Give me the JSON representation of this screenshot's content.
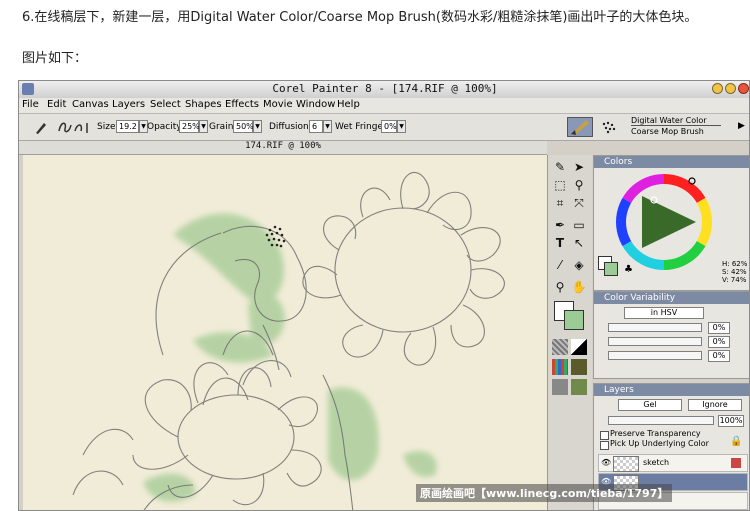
{
  "page": {
    "heading": "6.在线稿层下，新建一层，用Digital Water Color/Coarse Mop Brush(数码水彩/粗糙涂抹笔)画出叶子的大体色块。",
    "caption": "图片如下："
  },
  "window": {
    "title": "Corel Painter 8 - [174.RIF @ 100%]"
  },
  "menu": [
    "File",
    "Edit",
    "Canvas",
    "Layers",
    "Select",
    "Shapes",
    "Effects",
    "Movie",
    "Window",
    "Help"
  ],
  "property_bar": {
    "size_label": "Size:",
    "size_value": "19.2",
    "opacity_label": "Opacity:",
    "opacity_value": "25%",
    "grain_label": "Grain:",
    "grain_value": "50%",
    "diffusion_label": "Diffusion:",
    "diffusion_value": "6",
    "wet_fringe_label": "Wet Fringe:",
    "wet_fringe_value": "0%"
  },
  "brush_selector": {
    "category": "Digital Water Color",
    "variant": "Coarse Mop Brush"
  },
  "document": {
    "title": "174.RIF @ 100%"
  },
  "colors_panel": {
    "title": "Colors",
    "h": "H: 62%",
    "s": "S: 42%",
    "v": "V: 74%",
    "main_color": "#9ccc96",
    "secondary_color": "#ffffff"
  },
  "color_variability": {
    "title": "Color Variability",
    "mode": "in HSV",
    "values": [
      "0%",
      "0%",
      "0%"
    ]
  },
  "layers_panel": {
    "title": "Layers",
    "composite_method": "Gel",
    "depth": "Ignore",
    "opacity": "100%",
    "preserve_transparency": "Preserve Transparency",
    "pick_up_underlying": "Pick Up Underlying Color",
    "layers": [
      "sketch",
      ""
    ]
  },
  "watermark": "原画绘画吧【www.linecg.com/tieba/1797】"
}
